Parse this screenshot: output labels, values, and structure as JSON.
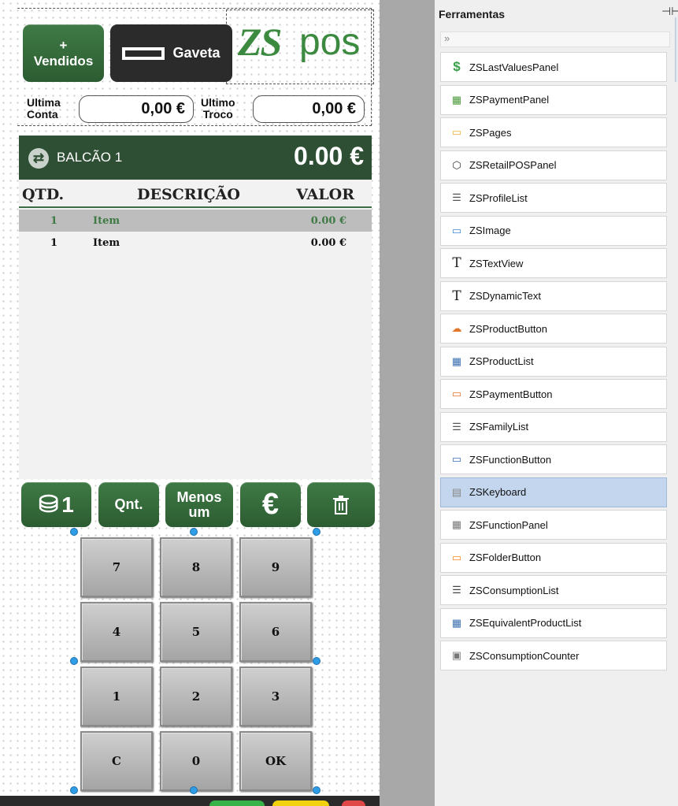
{
  "top_buttons": {
    "vendidos_label": "+\nVendidos",
    "gaveta_label": "Gaveta"
  },
  "logo": {
    "zs": "ZS",
    "pos": "pos"
  },
  "last": {
    "conta_label": "Ultima\nConta",
    "conta_value": "0,00 €",
    "troco_label": "Ultimo\nTroco",
    "troco_value": "0,00 €"
  },
  "table_bar": {
    "name": "BALCÃO 1",
    "total": "0.00 €"
  },
  "list": {
    "headers": {
      "qty": "QTD.",
      "desc": "DESCRIÇÃO",
      "value": "VALOR"
    },
    "rows": [
      {
        "qty": "1",
        "desc": "Item",
        "value": "0.00 €",
        "selected": true
      },
      {
        "qty": "1",
        "desc": "Item",
        "value": "0.00 €",
        "selected": false
      }
    ]
  },
  "func_buttons": {
    "plus_one": "1",
    "qnt": "Qnt.",
    "menos": "Menos\num",
    "euro": "€"
  },
  "keypad": [
    "7",
    "8",
    "9",
    "4",
    "5",
    "6",
    "1",
    "2",
    "3",
    "C",
    "0",
    "OK"
  ],
  "toolbox": {
    "title": "Ferramentas",
    "items": [
      {
        "label": "ZSLastValuesPanel",
        "icon": "dollar-icon",
        "color": "#3aa14a"
      },
      {
        "label": "ZSPaymentPanel",
        "icon": "cart-icon",
        "color": "#4a9a3a"
      },
      {
        "label": "ZSPages",
        "icon": "folder-icon",
        "color": "#e6b53b"
      },
      {
        "label": "ZSRetailPOSPanel",
        "icon": "box-icon",
        "color": "#333333"
      },
      {
        "label": "ZSProfileList",
        "icon": "list-icon",
        "color": "#555555"
      },
      {
        "label": "ZSImage",
        "icon": "image-icon",
        "color": "#3b8ad0"
      },
      {
        "label": "ZSTextView",
        "icon": "text-icon",
        "color": "#222222"
      },
      {
        "label": "ZSDynamicText",
        "icon": "text-icon",
        "color": "#222222"
      },
      {
        "label": "ZSProductButton",
        "icon": "cloud-icon",
        "color": "#e2762b"
      },
      {
        "label": "ZSProductList",
        "icon": "grid-icon",
        "color": "#3b6fb0"
      },
      {
        "label": "ZSPaymentButton",
        "icon": "card-icon",
        "color": "#e2762b"
      },
      {
        "label": "ZSFamilyList",
        "icon": "list-icon",
        "color": "#555555"
      },
      {
        "label": "ZSFunctionButton",
        "icon": "ok-button-icon",
        "color": "#3b6fb0"
      },
      {
        "label": "ZSKeyboard",
        "icon": "keyboard-icon",
        "color": "#888888",
        "active": true
      },
      {
        "label": "ZSFunctionPanel",
        "icon": "panel-icon",
        "color": "#777777"
      },
      {
        "label": "ZSFolderButton",
        "icon": "folder-button-icon",
        "color": "#f08a1e"
      },
      {
        "label": "ZSConsumptionList",
        "icon": "document-list-icon",
        "color": "#444444"
      },
      {
        "label": "ZSEquivalentProductList",
        "icon": "grid-icon",
        "color": "#3b6fb0"
      },
      {
        "label": "ZSConsumptionCounter",
        "icon": "counter-icon",
        "color": "#777777"
      }
    ]
  },
  "colors": {
    "pos_green": "#2c5c32",
    "table_bar": "#2f4f35",
    "selection_blue": "#c3d6ee"
  }
}
